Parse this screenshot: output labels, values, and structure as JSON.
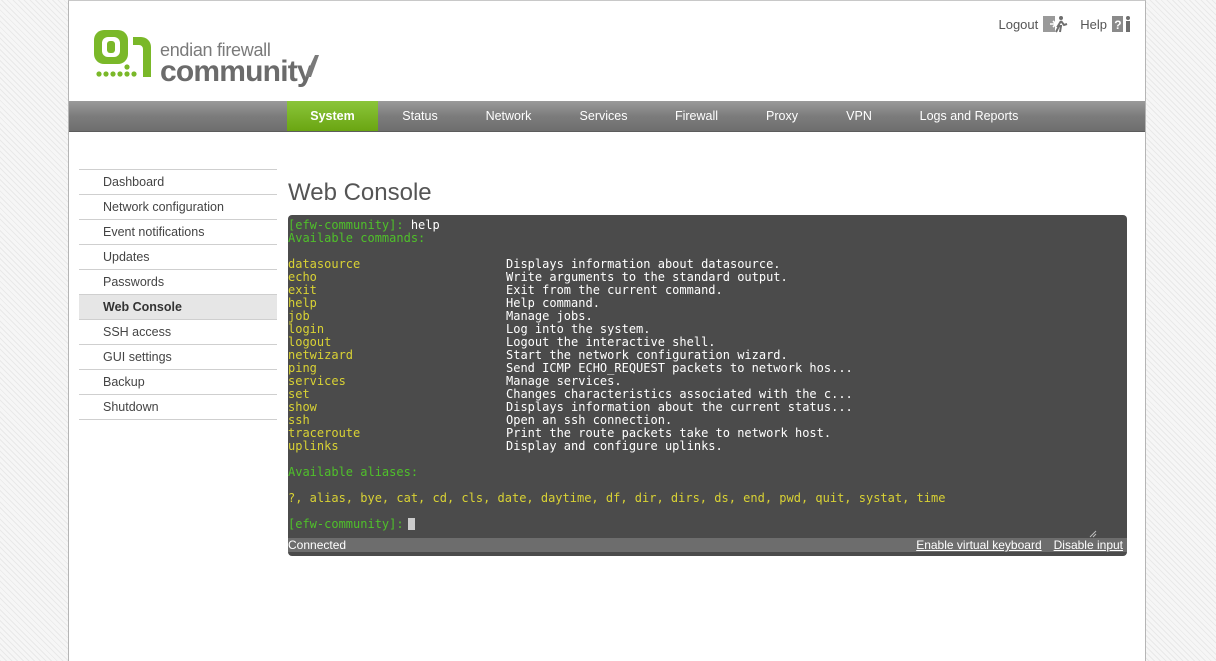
{
  "header": {
    "logo_top": "endian firewall",
    "logo_bottom": "community",
    "logout_label": "Logout",
    "help_label": "Help"
  },
  "nav": {
    "items": [
      "System",
      "Status",
      "Network",
      "Services",
      "Firewall",
      "Proxy",
      "VPN",
      "Logs and Reports"
    ],
    "active": "System"
  },
  "sidebar": {
    "items": [
      "Dashboard",
      "Network configuration",
      "Event notifications",
      "Updates",
      "Passwords",
      "Web Console",
      "SSH access",
      "GUI settings",
      "Backup",
      "Shutdown"
    ],
    "active": "Web Console"
  },
  "main": {
    "title": "Web Console"
  },
  "console": {
    "prompt": "[efw-community]:",
    "command": "help",
    "available_commands_label": "Available commands:",
    "commands": [
      {
        "name": "datasource",
        "desc": "Displays information about datasource."
      },
      {
        "name": "echo",
        "desc": "Write arguments to the standard output."
      },
      {
        "name": "exit",
        "desc": "Exit from the current command."
      },
      {
        "name": "help",
        "desc": "Help command."
      },
      {
        "name": "job",
        "desc": "Manage jobs."
      },
      {
        "name": "login",
        "desc": "Log into the system."
      },
      {
        "name": "logout",
        "desc": "Logout the interactive shell."
      },
      {
        "name": "netwizard",
        "desc": "Start the network configuration wizard."
      },
      {
        "name": "ping",
        "desc": "Send ICMP ECHO_REQUEST packets to network hos..."
      },
      {
        "name": "services",
        "desc": "Manage services."
      },
      {
        "name": "set",
        "desc": "Changes characteristics associated with the c..."
      },
      {
        "name": "show",
        "desc": "Displays information about the current status..."
      },
      {
        "name": "ssh",
        "desc": "Open an ssh connection."
      },
      {
        "name": "traceroute",
        "desc": "Print the route packets take to network host."
      },
      {
        "name": "uplinks",
        "desc": "Display and configure uplinks."
      }
    ],
    "available_aliases_label": "Available aliases:",
    "aliases": "?, alias, bye, cat, cd, cls, date, daytime, df, dir, dirs, ds, end, pwd, quit, systat, time",
    "status": "Connected",
    "keyboard_link": "Enable virtual keyboard",
    "disable_link": "Disable input"
  },
  "colors": {
    "accent_green": "#7ab829",
    "console_bg": "#4b4b4b",
    "prompt_green": "#4fc02a",
    "command_yellow": "#d9d234"
  }
}
